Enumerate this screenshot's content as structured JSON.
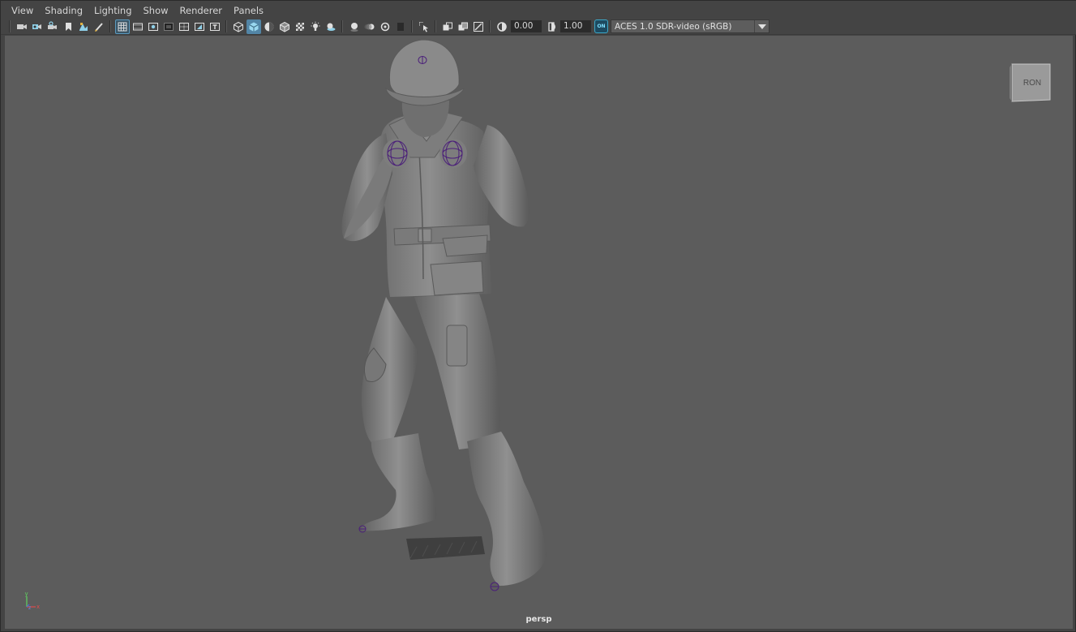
{
  "menu": {
    "items": [
      "View",
      "Shading",
      "Lighting",
      "Show",
      "Renderer",
      "Panels"
    ]
  },
  "toolbar": {
    "groups": [
      [
        "select-camera-icon",
        "camera-attributes-icon",
        "bookmark-icon",
        "bookmark-flag-icon",
        "image-plane-icon",
        "grease-pencil-icon"
      ],
      [
        "grid-icon",
        "film-gate-icon",
        "resolution-gate-icon",
        "gate-mask-icon",
        "field-chart-icon",
        "safe-action-icon",
        "safe-title-icon"
      ],
      [
        "wireframe-icon",
        "smooth-shade-icon",
        "default-material-icon",
        "wireframe-on-shaded-icon",
        "textured-icon",
        "use-all-lights-icon",
        "shadows-icon"
      ],
      [
        "screen-space-ao-icon",
        "motion-blur-icon",
        "multisample-aa-icon",
        "depth-of-field-icon"
      ],
      [
        "isolate-select-icon"
      ],
      [
        "xray-icon",
        "xray-active-icon",
        "xray-joints-icon"
      ]
    ],
    "exposure_value": "0.00",
    "gamma_value": "1.00",
    "color_management_badge": "ON",
    "color_space": "ACES 1.0 SDR-video (sRGB)"
  },
  "viewport": {
    "camera_label": "persp",
    "viewcube_label": "RON"
  },
  "axis": {
    "x": "x",
    "y": "y",
    "z": "z"
  },
  "colors": {
    "chrome_bg": "#444444",
    "viewport_bg": "#5c5c5c",
    "accent": "#5285a6",
    "control_curve": "#4b1f7a"
  }
}
